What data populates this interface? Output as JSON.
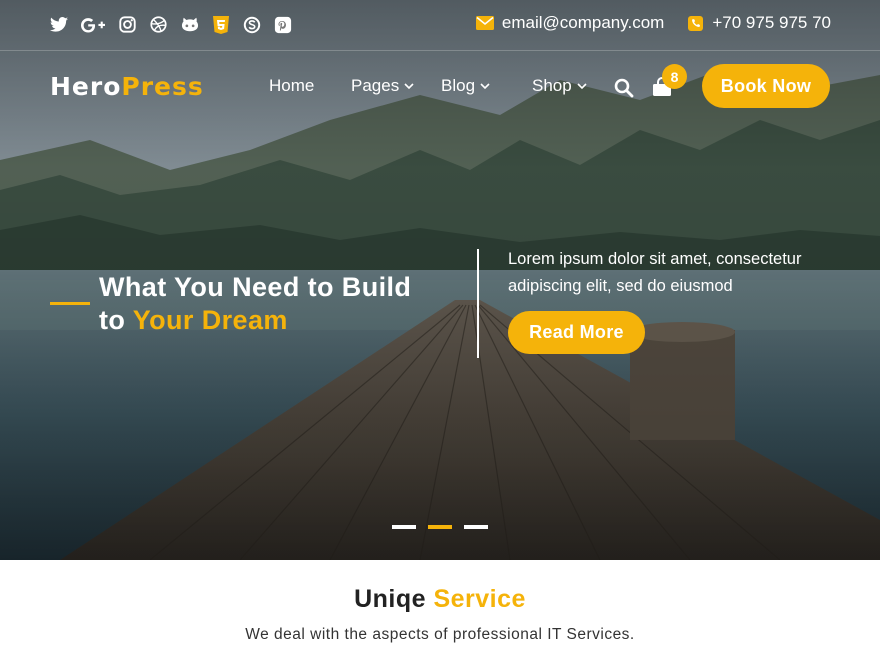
{
  "colors": {
    "accent": "#f5b30a",
    "text_dark": "#222222",
    "white": "#ffffff"
  },
  "topbar": {
    "socials": [
      "twitter-icon",
      "google-plus-icon",
      "instagram-icon",
      "dribbble-icon",
      "github-icon",
      "html5-icon",
      "skype-icon",
      "pinterest-icon"
    ],
    "email": "email@company.com",
    "phone": "+70 975 975 70"
  },
  "nav": {
    "logo_part1": "Hero",
    "logo_part2": "Press",
    "items": [
      {
        "label": "Home",
        "dropdown": false
      },
      {
        "label": "Pages",
        "dropdown": true
      },
      {
        "label": "Blog",
        "dropdown": true
      },
      {
        "label": "Shop",
        "dropdown": true
      }
    ],
    "cart_count": "8",
    "book_label": "Book Now"
  },
  "hero": {
    "headline_line1": "What You Need to Build",
    "headline_prefix": "to",
    "headline_highlight": "Your Dream",
    "description": "Lorem ipsum dolor sit amet, consectetur adipiscing elit, sed do eiusmod",
    "cta_label": "Read More",
    "slides_total": 3,
    "slide_active": 2
  },
  "service": {
    "title_plain": "Uniqe",
    "title_highlight": "Service",
    "subtitle": "We deal with the aspects of professional IT Services."
  }
}
